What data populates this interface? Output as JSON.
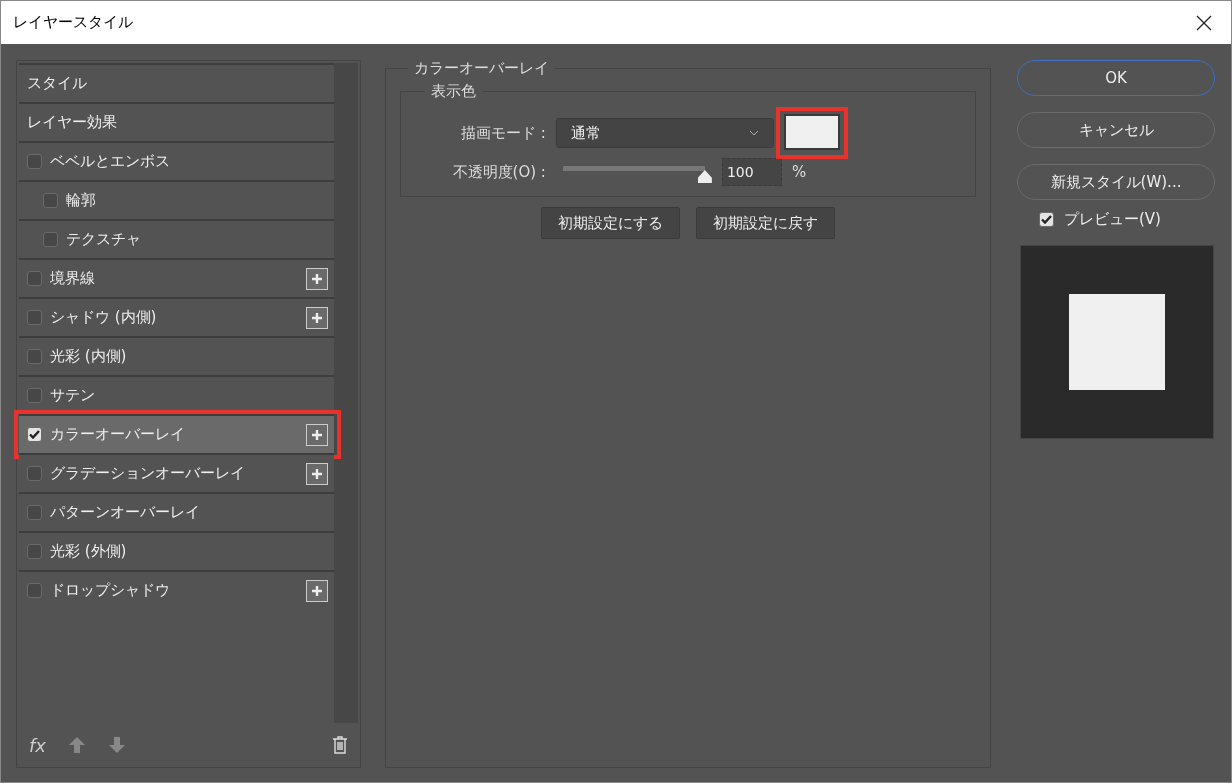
{
  "window": {
    "title": "レイヤースタイル"
  },
  "sidebar": {
    "items": [
      {
        "kind": "header",
        "label": "スタイル"
      },
      {
        "kind": "header",
        "label": "レイヤー効果"
      },
      {
        "kind": "effect",
        "label": "ベベルとエンボス",
        "checked": false,
        "selected": false,
        "addable": false,
        "highlighted": false,
        "children": [
          {
            "kind": "effect",
            "label": "輪郭",
            "checked": false,
            "selected": false,
            "addable": false,
            "highlighted": false
          },
          {
            "kind": "effect",
            "label": "テクスチャ",
            "checked": false,
            "selected": false,
            "addable": false,
            "highlighted": false
          }
        ]
      },
      {
        "kind": "effect",
        "label": "境界線",
        "checked": false,
        "selected": false,
        "addable": true,
        "highlighted": false
      },
      {
        "kind": "effect",
        "label": "シャドウ (内側)",
        "checked": false,
        "selected": false,
        "addable": true,
        "highlighted": false
      },
      {
        "kind": "effect",
        "label": "光彩 (内側)",
        "checked": false,
        "selected": false,
        "addable": false,
        "highlighted": false
      },
      {
        "kind": "effect",
        "label": "サテン",
        "checked": false,
        "selected": false,
        "addable": false,
        "highlighted": false
      },
      {
        "kind": "effect",
        "label": "カラーオーバーレイ",
        "checked": true,
        "selected": true,
        "addable": true,
        "highlighted": true
      },
      {
        "kind": "effect",
        "label": "グラデーションオーバーレイ",
        "checked": false,
        "selected": false,
        "addable": true,
        "highlighted": false
      },
      {
        "kind": "effect",
        "label": "パターンオーバーレイ",
        "checked": false,
        "selected": false,
        "addable": false,
        "highlighted": false
      },
      {
        "kind": "effect",
        "label": "光彩 (外側)",
        "checked": false,
        "selected": false,
        "addable": false,
        "highlighted": false
      },
      {
        "kind": "effect",
        "label": "ドロップシャドウ",
        "checked": false,
        "selected": false,
        "addable": true,
        "highlighted": false
      }
    ],
    "fx_label": "fx"
  },
  "panel": {
    "title": "カラーオーバーレイ",
    "group_title": "表示色",
    "blend_mode": {
      "label": "描画モード :",
      "value": "通常"
    },
    "swatch": {
      "color": "#f0f0f0",
      "highlighted": true
    },
    "opacity": {
      "label": "不透明度(O) :",
      "level": 1,
      "value": "100",
      "unit": "%"
    },
    "buttons": [
      "初期設定にする",
      "初期設定に戻す"
    ]
  },
  "actions": {
    "ok": "OK",
    "cancel": "キャンセル",
    "new_style": "新規スタイル(W)...",
    "preview": {
      "label": "プレビュー(V)",
      "checked": true
    }
  },
  "preview_swatch": {
    "color": "#f0f0f0"
  }
}
